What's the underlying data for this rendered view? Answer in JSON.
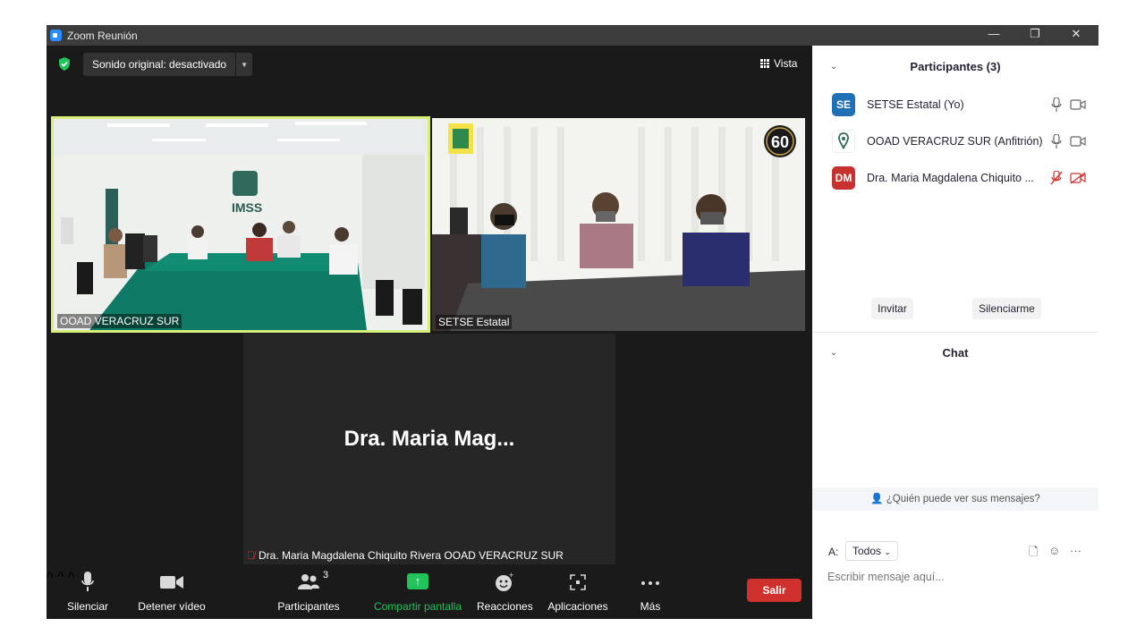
{
  "window": {
    "title": "Zoom Reunión",
    "controls": [
      "—",
      "❐",
      "✕"
    ]
  },
  "stage": {
    "sound_label": "Sonido original: desactivado",
    "view_label": "Vista",
    "tiles": [
      {
        "name": "OOAD VERACRUZ SUR",
        "active": true,
        "scene": "conference room with green table"
      },
      {
        "name": "SETSE Estatal",
        "badge": "60"
      },
      {
        "big_name": "Dra. Maria Mag...",
        "full_label": "Dra. Maria Magdalena Chiquito Rivera OOAD VERACRUZ SUR",
        "muted": true
      }
    ]
  },
  "toolbar": {
    "items": [
      {
        "label": "Silenciar",
        "icon": "microphone-icon"
      },
      {
        "label": "Detener vídeo",
        "icon": "video-camera-icon"
      },
      {
        "label": "Participantes",
        "icon": "participants-icon",
        "count": "3"
      },
      {
        "label": "Compartir pantalla",
        "icon": "share-screen-icon"
      },
      {
        "label": "Reacciones",
        "icon": "reactions-icon"
      },
      {
        "label": "Aplicaciones",
        "icon": "apps-icon"
      },
      {
        "label": "Más",
        "icon": "more-icon"
      }
    ],
    "leave_label": "Salir"
  },
  "panel": {
    "participants_title": "Participantes (3)",
    "participants": [
      {
        "initials": "SE",
        "name": "SETSE Estatal (Yo)",
        "color": "#1f6fb5",
        "muted": false
      },
      {
        "initials": "",
        "name": "OOAD VERACRUZ SUR (Anfitrión)",
        "color": "#ffffff",
        "muted": false
      },
      {
        "initials": "DM",
        "name": "Dra. Maria Magdalena Chiquito ...",
        "color": "#c8312e",
        "muted": true
      }
    ],
    "invite_label": "Invitar",
    "mute_me_label": "Silenciarme",
    "chat_title": "Chat",
    "who_can_see": "¿Quién puede ver sus mensajes?",
    "to_label": "A:",
    "to_value": "Todos",
    "message_placeholder": "Escribir mensaje aquí..."
  },
  "colors": {
    "accent_green": "#21c45a",
    "leave_red": "#d0312d",
    "active_border": "#d8ee7a"
  }
}
